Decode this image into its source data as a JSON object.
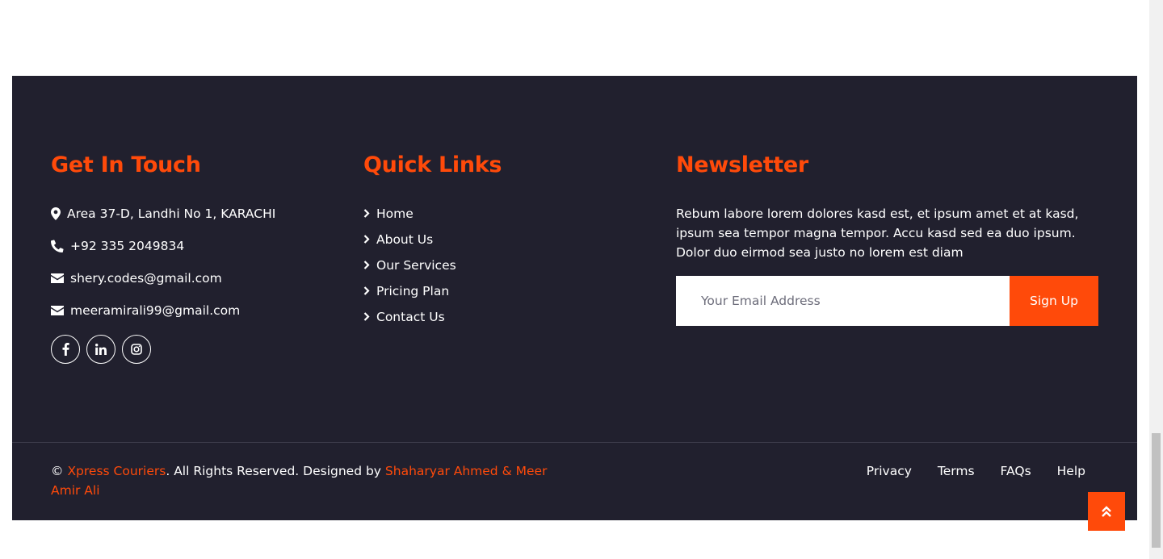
{
  "get_in_touch": {
    "title": "Get In Touch",
    "address": "Area 37-D, Landhi No 1, KARACHI",
    "phone": "+92 335 2049834",
    "email_1": "shery.codes@gmail.com",
    "email_2": "meeramirali99@gmail.com",
    "socials": [
      "facebook-icon",
      "linkedin-icon",
      "instagram-icon"
    ]
  },
  "quick_links": {
    "title": "Quick Links",
    "items": [
      "Home",
      "About Us",
      "Our Services",
      "Pricing Plan",
      "Contact Us"
    ]
  },
  "newsletter": {
    "title": "Newsletter",
    "text": "Rebum labore lorem dolores kasd est, et ipsum amet et at kasd, ipsum sea tempor magna tempor. Accu kasd sed ea duo ipsum. Dolor duo eirmod sea justo no lorem est diam",
    "email_placeholder": "Your Email Address",
    "email_value": "",
    "button_label": "Sign Up"
  },
  "copyright": {
    "symbol": "©",
    "brand": "Xpress Couriers",
    "middle": ". All Rights Reserved. Designed by ",
    "designers": "Shaharyar Ahmed & Meer Amir Ali"
  },
  "footer_menu": [
    "Privacy",
    "Terms",
    "FAQs",
    "Help"
  ],
  "colors": {
    "accent": "#ff4a0a",
    "footer_bg": "#21202e",
    "text": "#ffffff"
  }
}
